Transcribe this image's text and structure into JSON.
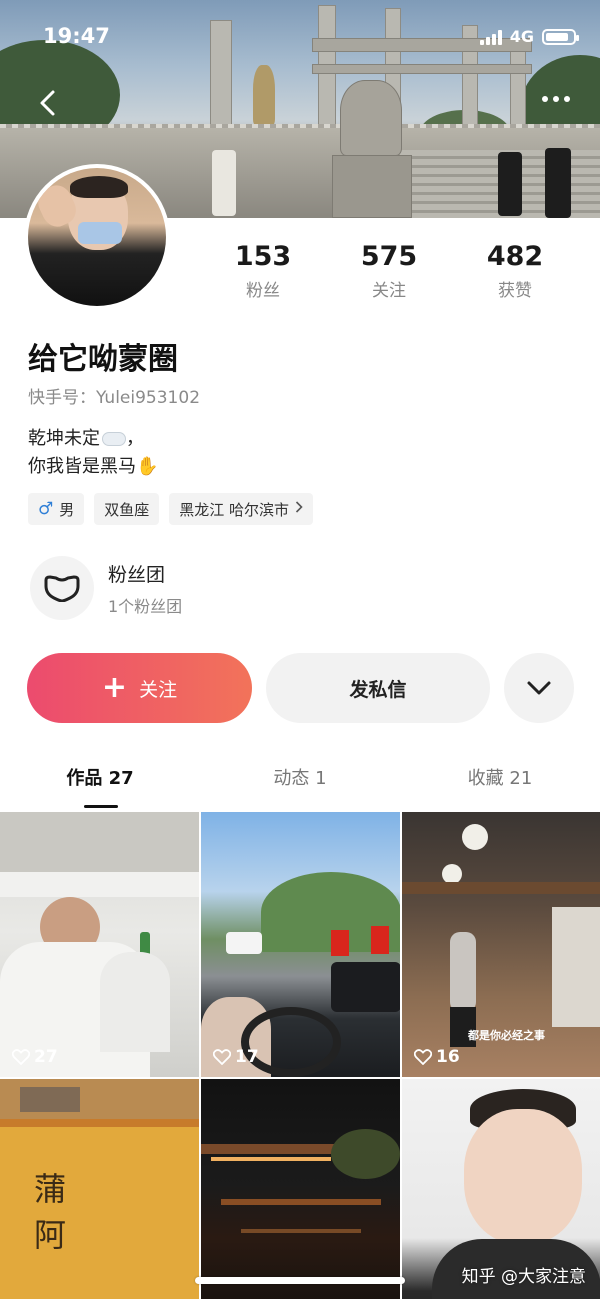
{
  "status_bar": {
    "time": "19:47",
    "network": "4G"
  },
  "profile": {
    "name": "给它呦蒙圈",
    "kuaishou_id": "快手号：Yulei953102",
    "bio_line1": "乾坤未定",
    "bio_line1_suffix": "，",
    "bio_line2": "你我皆是黑马",
    "stats": [
      {
        "value": "153",
        "label": "粉丝"
      },
      {
        "value": "575",
        "label": "关注"
      },
      {
        "value": "482",
        "label": "获赞"
      }
    ],
    "tags": {
      "gender": "男",
      "gender_icon": "♂",
      "zodiac": "双鱼座",
      "location": "黑龙江 哈尔滨市"
    },
    "fan_group": {
      "title": "粉丝团",
      "subtitle": "1个粉丝团"
    }
  },
  "actions": {
    "follow_label": "关注",
    "message_label": "发私信"
  },
  "tabs": [
    {
      "label": "作品 27"
    },
    {
      "label": "动态 1"
    },
    {
      "label": "收藏 21"
    }
  ],
  "posts": [
    {
      "likes": "27"
    },
    {
      "likes": "17"
    },
    {
      "likes": "16",
      "caption": "都是你必经之事"
    },
    {
      "caption": "蒲 阿"
    },
    {},
    {}
  ],
  "watermark": "知乎 @大家注意",
  "icons": {
    "back": "back-arrow-icon",
    "more": "more-dots-icon",
    "fan_group": "heart-mask-icon",
    "chevron": "chevron-down-icon",
    "like": "heart-outline-icon"
  },
  "colors": {
    "accent_start": "#ec4b6e",
    "accent_end": "#f2735a",
    "male": "#2f7fd6"
  }
}
